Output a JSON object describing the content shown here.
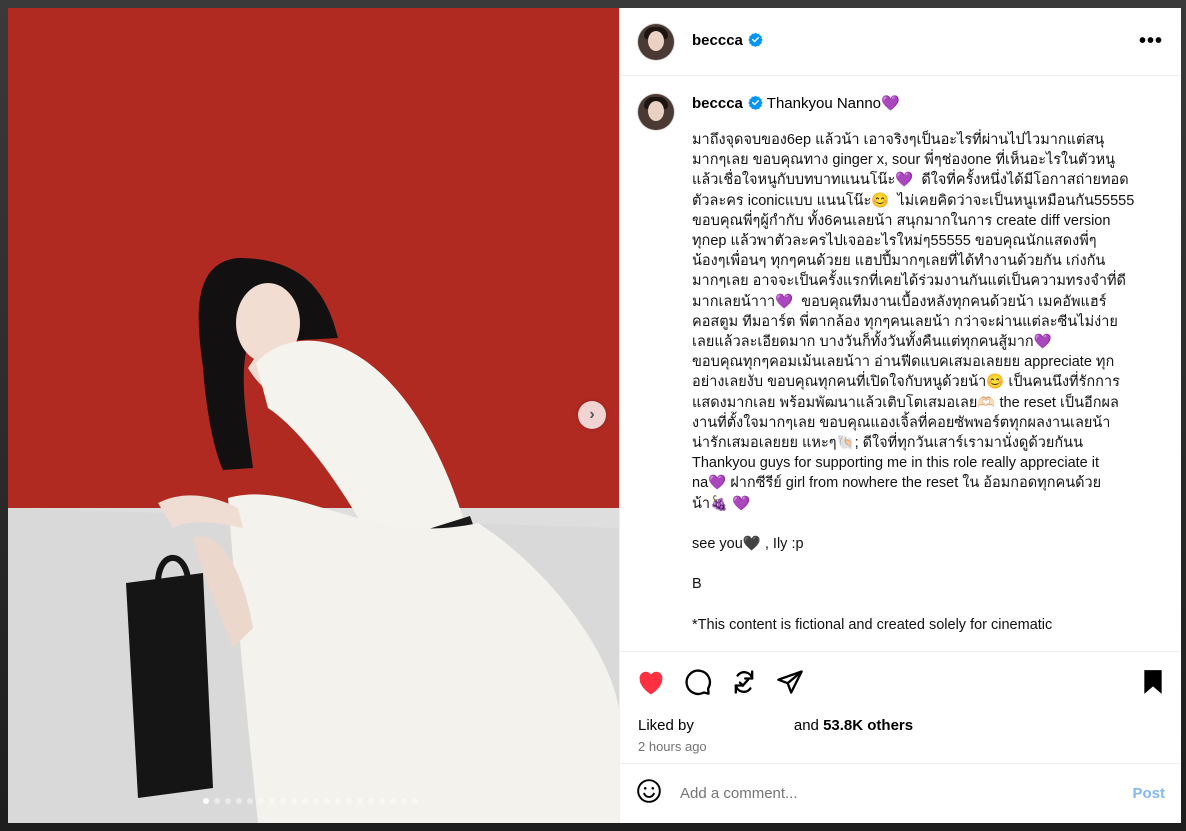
{
  "post": {
    "username": "beccca",
    "more_label": "•••",
    "caption_title": "Thankyou Nanno💜",
    "caption_text": "มาถึงจุดจบของ6ep แล้วน้า เอาจริงๆเป็นอะไรที่ผ่านไปไวมากแต่สนุ\nมากๆเลย ขอบคุณทาง ginger x, sour พี่ๆช่องone ที่เห็นอะไรในตัวหนู\nแล้วเชื่อใจหนูกับบทบาทแนนโน๊ะ💜  ดีใจที่ครั้งหนึ่งได้มีโอกาสถ่ายทอด\nตัวละคร iconicแบบ แนนโน๊ะ😊  ไม่เคยคิดว่าจะเป็นหนูเหมือนกัน55555\nขอบคุณพี่ๆผู้กำกับ ทั้ง6คนเลยน้า สนุกมากในการ create diff version\nทุกep แล้วพาตัวละครไปเจออะไรใหม่ๆ55555 ขอบคุณนักแสดงพี่ๆ\nน้องๆเพื่อนๆ ทุกๆคนด้วยย แฮปปี้มากๆเลยที่ได้ทำงานด้วยกัน เก่งกัน\nมากๆเลย อาจจะเป็นครั้งแรกที่เคยได้ร่วมงานกันแต่เป็นความทรงจำที่ดี\nมากเลยน้าาา💜  ขอบคุณทีมงานเบื้องหลังทุกคนด้วยน้า เมคอัพแฮร์\nคอสตูม ทีมอาร์ต พี่ตากล้อง ทุกๆคนเลยน้า กว่าจะผ่านแต่ละซีนไม่ง่าย\nเลยแล้วละเอียดมาก บางวันก็ทั้งวันทั้งคืนแต่ทุกคนสู้มาก💜\nขอบคุณทุกๆคอมเม้นเลยน้าา อ่านฟีดแบคเสมอเลยยย appreciate ทุก\nอย่างเลยงับ ขอบคุณทุกคนที่เปิดใจกับหนูด้วยน้า😊 เป็นคนนึงที่รักการ\nแสดงมากเลย พร้อมพัฒนาแล้วเติบโตเสมอเลย🫶🏻 the reset เป็นอีกผล\nงานที่ตั้งใจมากๆเลย ขอบคุณแองเจิ้ลที่คอยซัพพอร์ตทุกผลงานเลยน้า\nน่ารักเสมอเลยยย แหะๆ🐚; ดีใจที่ทุกวันเสาร์เรามานั่งดูด้วยกันน\nThankyou guys for supporting me in this role really appreciate it\nna💜 ฝากซีรีย์ girl from nowhere the reset ใน อ้อมกอดทุกคนด้วย\nน้า🍇 💜\n\nsee you🖤 , Ily :p\n\nB\n\n*This content is fictional and created solely for cinematic",
    "liked_by_label": "Liked by",
    "likes_suffix_pre": "and",
    "likes_count": "53.8K others",
    "time_ago": "2 hours ago",
    "comment_placeholder": "Add a comment...",
    "post_label": "Post",
    "next_arrow": "›",
    "slide_count": 20,
    "active_slide": 1
  },
  "icons": {
    "verified": "verified-badge-icon",
    "like": "heart-icon",
    "comment": "comment-bubble-icon",
    "repost": "repost-icon",
    "share": "paper-plane-icon",
    "save": "bookmark-icon",
    "emoji": "emoji-smile-icon"
  },
  "colors": {
    "like_active": "#ff3040",
    "verified": "#0095f6",
    "post_disabled": "#85b8f0",
    "backdrop_wall": "#b32b23"
  }
}
